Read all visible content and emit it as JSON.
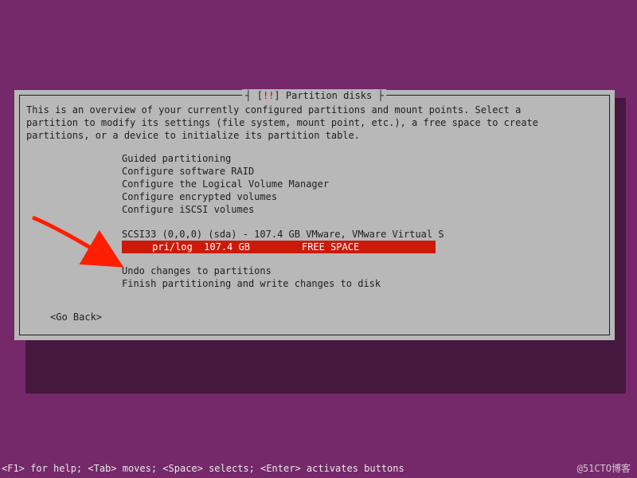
{
  "dialog": {
    "title_left": "[",
    "title_emph": "!!",
    "title_mid": "] ",
    "title_text": "Partition disks",
    "title_close": "",
    "intro": "This is an overview of your currently configured partitions and mount points. Select a\npartition to modify its settings (file system, mount point, etc.), a free space to create\npartitions, or a device to initialize its partition table."
  },
  "menu": {
    "items": [
      "Guided partitioning",
      "Configure software RAID",
      "Configure the Logical Volume Manager",
      "Configure encrypted volumes",
      "Configure iSCSI volumes"
    ]
  },
  "disks": {
    "device_line": "SCSI33 (0,0,0) (sda) - 107.4 GB VMware, VMware Virtual S",
    "selected_line": "     pri/log  107.4 GB         FREE SPACE             "
  },
  "actions": {
    "items": [
      "Undo changes to partitions",
      "Finish partitioning and write changes to disk"
    ],
    "go_back": "<Go Back>"
  },
  "footer": {
    "help": "<F1> for help; <Tab> moves; <Space> selects; <Enter> activates buttons",
    "watermark": "@51CTO博客"
  },
  "colors": {
    "background": "#75296a",
    "panel": "#b8b8b8",
    "accent_red": "#cc1a0a"
  }
}
